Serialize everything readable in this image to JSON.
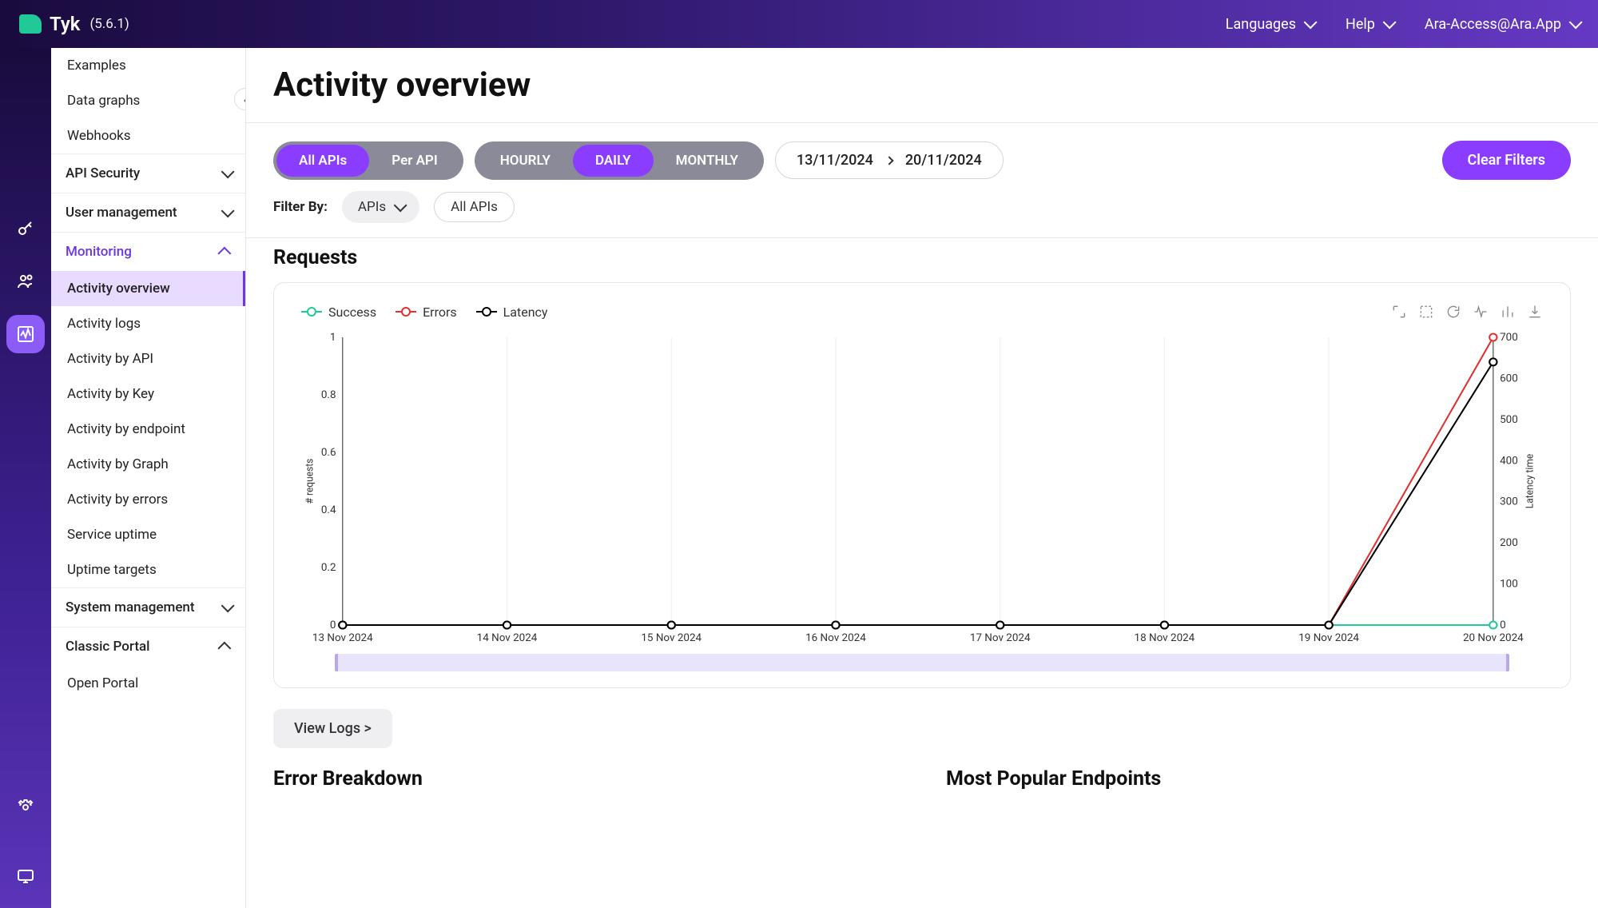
{
  "topbar": {
    "logo_text": "Tyk",
    "version": "(5.6.1)",
    "languages": "Languages",
    "help": "Help",
    "user": "Ara-Access@Ara.App"
  },
  "sidebar": {
    "top_items": [
      "Examples",
      "Data graphs",
      "Webhooks"
    ],
    "sections": [
      {
        "label": "API Security",
        "expanded": false
      },
      {
        "label": "User management",
        "expanded": false
      },
      {
        "label": "Monitoring",
        "expanded": true,
        "active": true,
        "children": [
          "Activity overview",
          "Activity logs",
          "Activity by API",
          "Activity by Key",
          "Activity by endpoint",
          "Activity by Graph",
          "Activity by errors",
          "Service uptime",
          "Uptime targets"
        ],
        "selected": "Activity overview"
      },
      {
        "label": "System management",
        "expanded": false
      },
      {
        "label": "Classic Portal",
        "expanded": true,
        "children": [
          "Open Portal"
        ]
      }
    ]
  },
  "page": {
    "title": "Activity overview"
  },
  "controls": {
    "api_scope": [
      "All APIs",
      "Per API"
    ],
    "api_scope_active": "All APIs",
    "granularity": [
      "HOURLY",
      "DAILY",
      "MONTHLY"
    ],
    "granularity_active": "DAILY",
    "date_from": "13/11/2024",
    "date_to": "20/11/2024",
    "clear_filters": "Clear Filters"
  },
  "filter": {
    "label": "Filter By:",
    "dropdown": "APIs",
    "tag": "All APIs"
  },
  "requests": {
    "title": "Requests",
    "legend": {
      "success": "Success",
      "errors": "Errors",
      "latency": "Latency"
    },
    "view_logs": "View Logs >"
  },
  "bottom": {
    "left": "Error Breakdown",
    "right": "Most Popular Endpoints"
  },
  "chart_data": {
    "type": "line",
    "x": [
      "13 Nov 2024",
      "14 Nov 2024",
      "15 Nov 2024",
      "16 Nov 2024",
      "17 Nov 2024",
      "18 Nov 2024",
      "19 Nov 2024",
      "20 Nov 2024"
    ],
    "series": [
      {
        "name": "Success",
        "axis": "left",
        "values": [
          0,
          0,
          0,
          0,
          0,
          0,
          0,
          0
        ]
      },
      {
        "name": "Errors",
        "axis": "left",
        "values": [
          0,
          0,
          0,
          0,
          0,
          0,
          0,
          1
        ]
      },
      {
        "name": "Latency",
        "axis": "right",
        "values": [
          0,
          0,
          0,
          0,
          0,
          0,
          0,
          640
        ]
      }
    ],
    "ylabel_left": "# requests",
    "ylabel_right": "Latency time",
    "ylim_left": [
      0,
      1
    ],
    "yticks_left": [
      0,
      0.2,
      0.4,
      0.6,
      0.8,
      1
    ],
    "ylim_right": [
      0,
      700
    ],
    "yticks_right": [
      0,
      100,
      200,
      300,
      400,
      500,
      600,
      700
    ]
  }
}
